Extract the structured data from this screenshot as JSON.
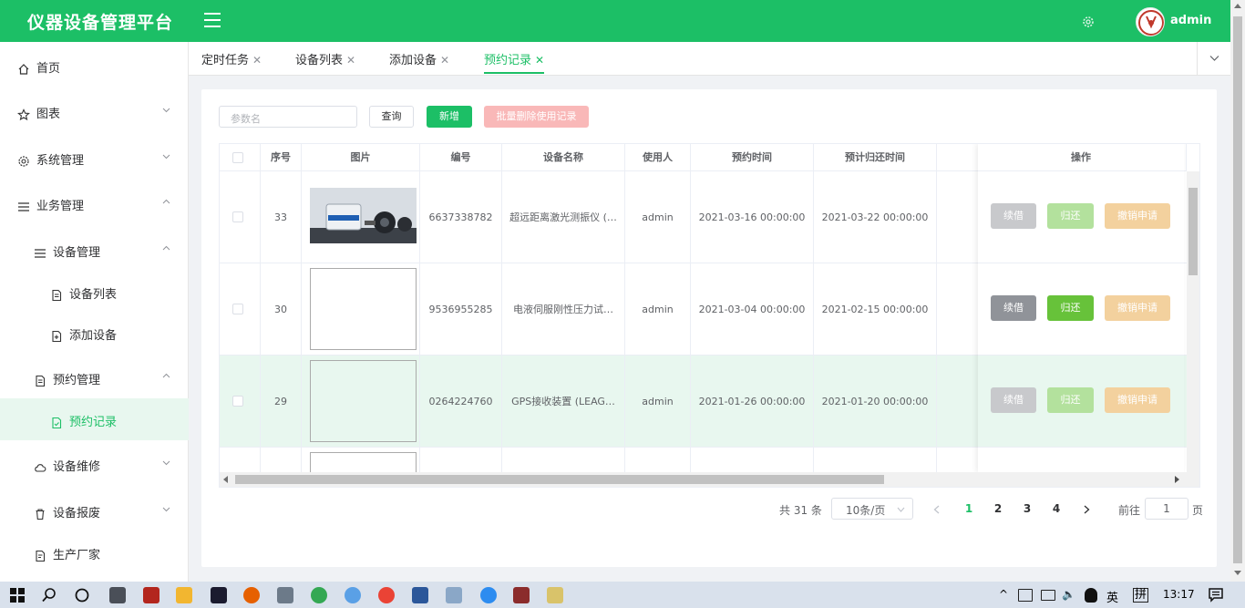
{
  "header": {
    "title": "仪器设备管理平台",
    "user": "admin",
    "brand_color": "#1cbf66"
  },
  "sidebar": {
    "items": [
      {
        "label": "首页",
        "icon": "home-icon"
      },
      {
        "label": "图表",
        "icon": "star-icon"
      },
      {
        "label": "系统管理",
        "icon": "gear-icon"
      },
      {
        "label": "业务管理",
        "icon": "menu-icon"
      },
      {
        "label": "设备管理",
        "icon": "menu-icon"
      },
      {
        "label": "设备列表",
        "icon": "document-icon"
      },
      {
        "label": "添加设备",
        "icon": "document-add-icon"
      },
      {
        "label": "预约管理",
        "icon": "document-icon"
      },
      {
        "label": "预约记录",
        "icon": "document-check-icon"
      },
      {
        "label": "设备维修",
        "icon": "cloud-icon"
      },
      {
        "label": "设备报废",
        "icon": "trash-icon"
      },
      {
        "label": "生产厂家",
        "icon": "factory-icon"
      }
    ]
  },
  "tabs": [
    {
      "label": "定时任务"
    },
    {
      "label": "设备列表"
    },
    {
      "label": "添加设备"
    },
    {
      "label": "预约记录",
      "active": true
    }
  ],
  "toolbar": {
    "search_placeholder": "参数名",
    "query_label": "查询",
    "add_label": "新增",
    "batch_delete_label": "批量删除使用记录"
  },
  "table": {
    "headers": [
      "序号",
      "图片",
      "编号",
      "设备名称",
      "使用人",
      "预约时间",
      "预计归还时间",
      "操作"
    ],
    "rows": [
      {
        "id": "33",
        "code": "6637338782",
        "name": "超远距离激光测振仪 (…",
        "user": "admin",
        "reserve_time": "2021-03-16 00:00:00",
        "return_time": "2021-03-22 00:00:00",
        "has_image": true
      },
      {
        "id": "30",
        "code": "9536955285",
        "name": "电液伺服刚性压力试…",
        "user": "admin",
        "reserve_time": "2021-03-04 00:00:00",
        "return_time": "2021-02-15 00:00:00",
        "has_image": false
      },
      {
        "id": "29",
        "code": "0264224760",
        "name": "GPS接收装置 (LEAG…",
        "user": "admin",
        "reserve_time": "2021-01-26 00:00:00",
        "return_time": "2021-01-20 00:00:00",
        "has_image": false
      }
    ],
    "actions": {
      "renew": "续借",
      "return": "归还",
      "cancel": "撤销申请"
    }
  },
  "pagination": {
    "total": "共 31 条",
    "page_size": "10条/页",
    "pages": [
      "1",
      "2",
      "3",
      "4"
    ],
    "current": "1",
    "goto_label": "前往",
    "goto_value": "1",
    "unit": "页"
  },
  "taskbar": {
    "time": "13:17",
    "ime_lang": "英",
    "ime_mode": "拼"
  }
}
